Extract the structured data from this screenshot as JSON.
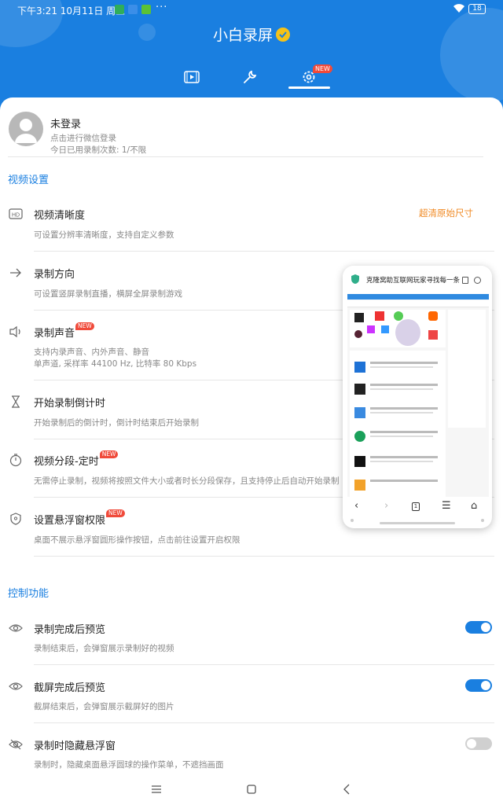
{
  "status_bar": {
    "time": "下午3:21",
    "date": "10月11日 周三",
    "dots": "···",
    "battery": "18"
  },
  "app": {
    "title": "小白录屏",
    "tabs": [
      {
        "icon": "video-icon"
      },
      {
        "icon": "wrench-icon"
      },
      {
        "icon": "gear-icon",
        "badge": "NEW",
        "active": true
      }
    ]
  },
  "user": {
    "name": "未登录",
    "login_hint": "点击进行微信登录",
    "usage": "今日已用录制次数: 1/不限"
  },
  "sections": {
    "video": "视频设置",
    "control": "控制功能"
  },
  "video_settings": [
    {
      "icon": "hd-icon",
      "title": "视频清晰度",
      "desc": "可设置分辨率清晰度，支持自定义参数",
      "value": "超清原始尺寸"
    },
    {
      "icon": "arrow-right-icon",
      "title": "录制方向",
      "desc": "可设置竖屏录制直播，横屏全屏录制游戏"
    },
    {
      "icon": "speaker-icon",
      "title": "录制声音",
      "badge": "NEW",
      "desc": "支持内录声音、内外声音、静音",
      "desc2": "单声道, 采样率 44100 Hz, 比特率 80 Kbps"
    },
    {
      "icon": "hourglass-icon",
      "title": "开始录制倒计时",
      "desc": "开始录制后的倒计时，倒计时结束后开始录制"
    },
    {
      "icon": "stopwatch-icon",
      "title": "视频分段-定时",
      "badge": "NEW",
      "desc": "无需停止录制，视频将按照文件大小或者时长分段保存，且支持停止后自动开始录制"
    },
    {
      "icon": "shield-icon",
      "title": "设置悬浮窗权限",
      "badge": "NEW",
      "desc": "桌面不展示悬浮窗圆形操作按钮，点击前往设置开启权限"
    }
  ],
  "control_settings": [
    {
      "icon": "eye-icon",
      "title": "录制完成后预览",
      "desc": "录制结束后，会弹窗展示录制好的视频",
      "enabled": true
    },
    {
      "icon": "eye-icon",
      "title": "截屏完成后预览",
      "desc": "截屏结束后，会弹窗展示截屏好的图片",
      "enabled": true
    },
    {
      "icon": "eye-off-icon",
      "title": "录制时隐藏悬浮窗",
      "desc": "录制时，隐藏桌面悬浮圆球的操作菜单，不遮挡画面",
      "enabled": false
    }
  ],
  "pip": {
    "title": "克隆窝助互联网玩家寻找每一条"
  },
  "colors": {
    "primary": "#1a7fe0",
    "accent_orange": "#f08a24",
    "new_badge": "#f04a3a",
    "toggle_off": "#d0d0d0"
  }
}
